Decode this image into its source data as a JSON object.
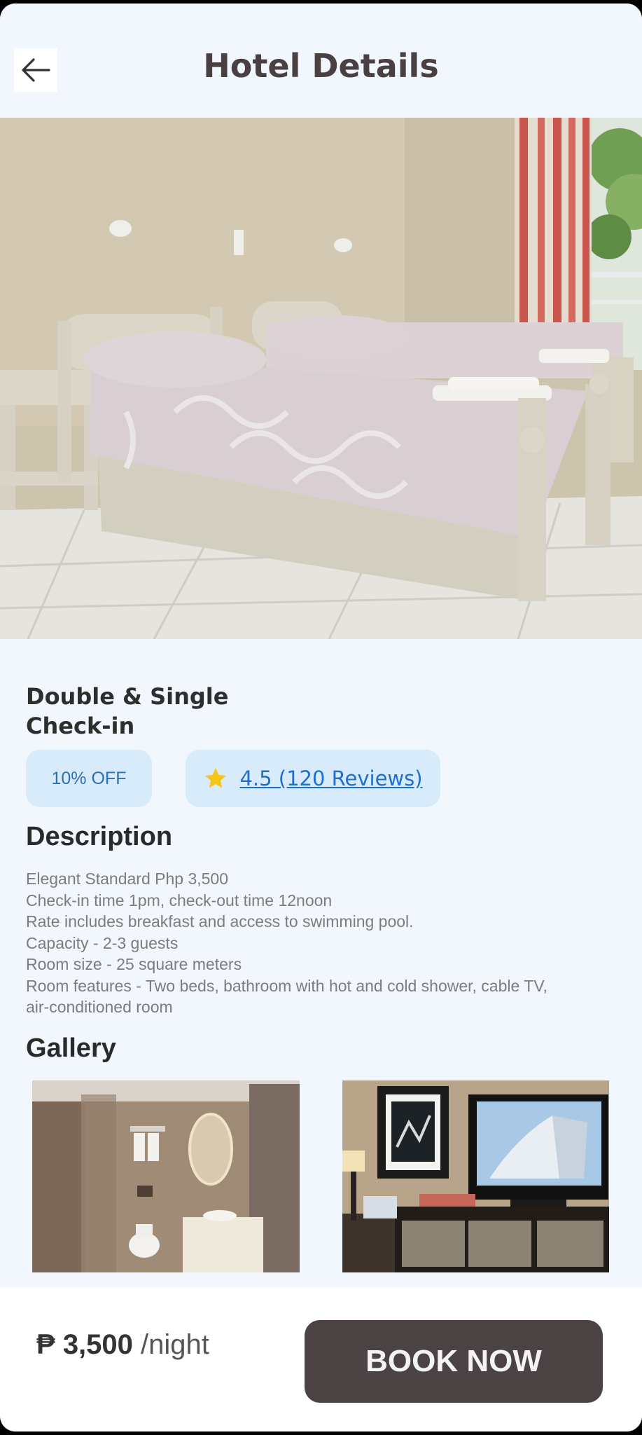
{
  "header": {
    "title": "Hotel Details",
    "back_icon": "arrow-left-icon"
  },
  "room": {
    "name_line1": "Double & Single",
    "name_line2": "Check-in"
  },
  "chips": {
    "discount": "10% OFF",
    "rating_icon": "star-icon",
    "rating": "4.5 (120 Reviews)"
  },
  "description": {
    "title": "Description",
    "lines": [
      "Elegant Standard Php 3,500",
      "Check-in  time 1pm, check-out time 12noon",
      "Rate includes breakfast and access to swimming pool.",
      "Capacity - 2-3 guests",
      "Room size - 25 square meters",
      "Room features - Two beds, bathroom with hot and cold shower, cable TV,",
      "air-conditioned room"
    ]
  },
  "gallery": {
    "title": "Gallery"
  },
  "booking": {
    "currency": "₱",
    "amount": "3,500",
    "unit": "/night",
    "button": "BOOK NOW"
  },
  "colors": {
    "background": "#f1f7fd",
    "chip": "#d8ebfb",
    "link": "#1f6fd0",
    "star": "#f5c518",
    "button": "#4b4243"
  }
}
